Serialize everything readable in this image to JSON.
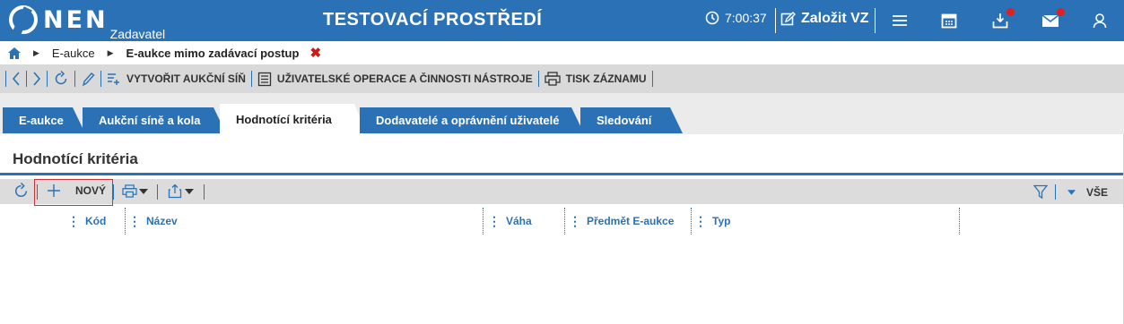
{
  "header": {
    "logo_text": "NEN",
    "logo_sub": "Zadavatel",
    "env_title": "TESTOVACÍ PROSTŘEDÍ",
    "clock": "7:00:37",
    "create_label": "Založit VZ",
    "accent": "#2a72b5"
  },
  "breadcrumb": {
    "items": [
      "E-aukce",
      "E-aukce mimo zadávací postup"
    ],
    "close_glyph": "✖"
  },
  "toolbar": {
    "create_hall": "VYTVOŘIT AUKČNÍ SÍŇ",
    "user_ops": "UŽIVATELSKÉ OPERACE A ČINNOSTI NÁSTROJE",
    "print": "TISK ZÁZNAMU"
  },
  "tabs": [
    {
      "label": "E-aukce"
    },
    {
      "label": "Aukční síně a kola"
    },
    {
      "label": "Hodnotící kritéria"
    },
    {
      "label": "Dodavatelé a oprávnění uživatelé"
    },
    {
      "label": "Sledování"
    }
  ],
  "section": {
    "title": "Hodnotící kritéria"
  },
  "grid": {
    "new_label": "NOVÝ",
    "filter_label": "VŠE",
    "columns": [
      "Kód",
      "Název",
      "Váha",
      "Předmět E-aukce",
      "Typ"
    ]
  }
}
